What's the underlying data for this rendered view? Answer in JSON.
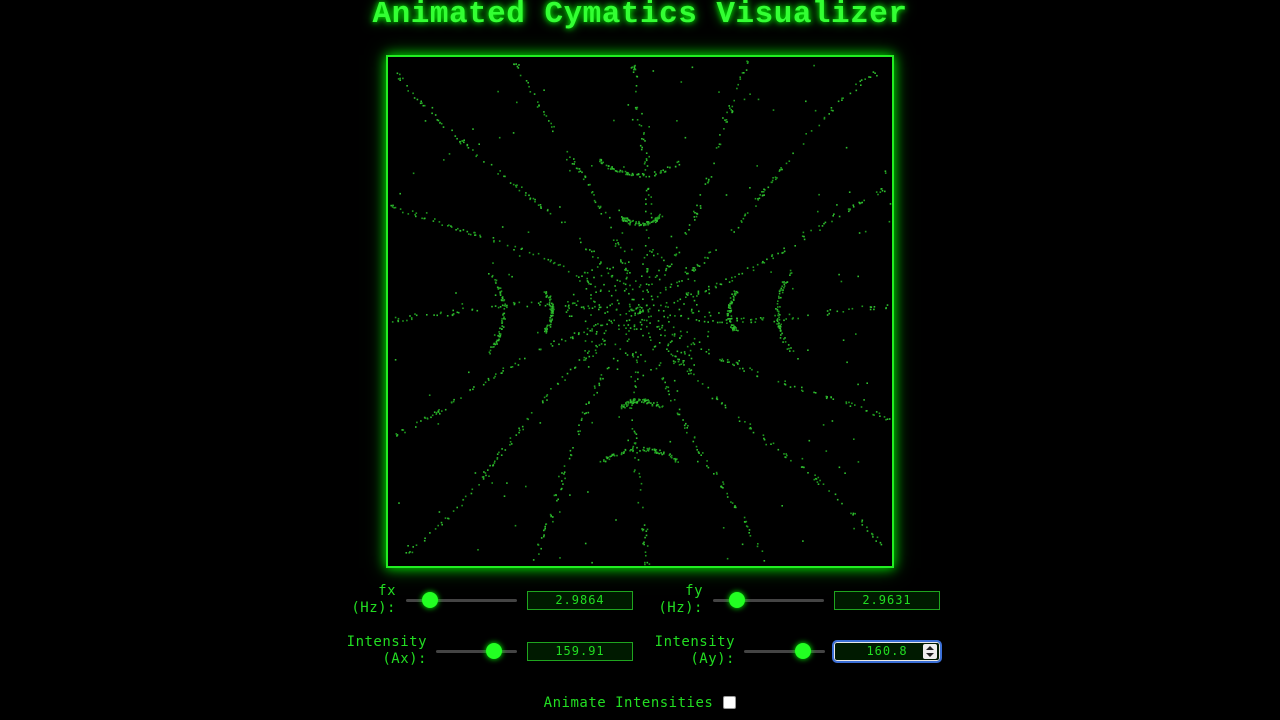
{
  "title": "Animated Cymatics Visualizer",
  "colors": {
    "accent": "#22ff22",
    "text": "#22dd22",
    "background": "#000000"
  },
  "controls": {
    "fx": {
      "label_line1": "fx",
      "label_line2": "(Hz):",
      "value": "2.9864",
      "level": 0.22
    },
    "fy": {
      "label_line1": "fy",
      "label_line2": "(Hz):",
      "value": "2.9631",
      "level": 0.22
    },
    "ax": {
      "label_line1": "Intensity",
      "label_line2": "(Ax):",
      "value": "159.91",
      "level": 0.72
    },
    "ay": {
      "label_line1": "Intensity",
      "label_line2": "(Ay):",
      "value": "160.8",
      "level": 0.73
    }
  },
  "animate": {
    "label": "Animate Intensities",
    "checked": false
  }
}
